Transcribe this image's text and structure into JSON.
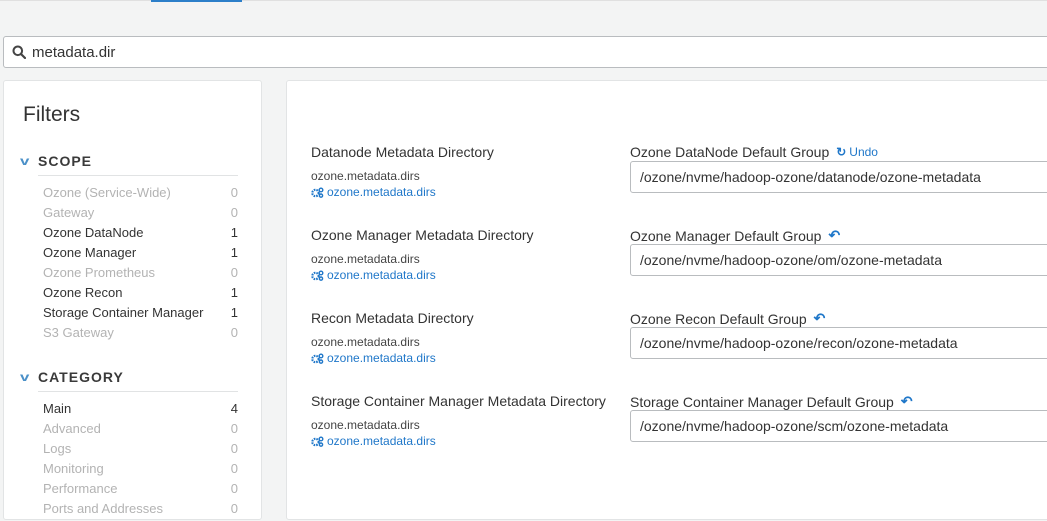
{
  "search": {
    "value": "metadata.dir"
  },
  "filters": {
    "title": "Filters",
    "scope": {
      "label": "SCOPE",
      "items": [
        {
          "label": "Ozone (Service-Wide)",
          "count": "0",
          "active": false
        },
        {
          "label": "Gateway",
          "count": "0",
          "active": false
        },
        {
          "label": "Ozone DataNode",
          "count": "1",
          "active": true
        },
        {
          "label": "Ozone Manager",
          "count": "1",
          "active": true
        },
        {
          "label": "Ozone Prometheus",
          "count": "0",
          "active": false
        },
        {
          "label": "Ozone Recon",
          "count": "1",
          "active": true
        },
        {
          "label": "Storage Container Manager",
          "count": "1",
          "active": true
        },
        {
          "label": "S3 Gateway",
          "count": "0",
          "active": false
        }
      ]
    },
    "category": {
      "label": "CATEGORY",
      "items": [
        {
          "label": "Main",
          "count": "4",
          "active": true
        },
        {
          "label": "Advanced",
          "count": "0",
          "active": false
        },
        {
          "label": "Logs",
          "count": "0",
          "active": false
        },
        {
          "label": "Monitoring",
          "count": "0",
          "active": false
        },
        {
          "label": "Performance",
          "count": "0",
          "active": false
        },
        {
          "label": "Ports and Addresses",
          "count": "0",
          "active": false
        }
      ]
    }
  },
  "configs": [
    {
      "title": "Datanode Metadata Directory",
      "key": "ozone.metadata.dirs",
      "link": "ozone.metadata.dirs",
      "group": "Ozone DataNode Default Group",
      "action": "undo",
      "undo_label": "Undo",
      "value": "/ozone/nvme/hadoop-ozone/datanode/ozone-metadata"
    },
    {
      "title": "Ozone Manager Metadata Directory",
      "key": "ozone.metadata.dirs",
      "link": "ozone.metadata.dirs",
      "group": "Ozone Manager Default Group",
      "action": "revert",
      "value": "/ozone/nvme/hadoop-ozone/om/ozone-metadata"
    },
    {
      "title": "Recon Metadata Directory",
      "key": "ozone.metadata.dirs",
      "link": "ozone.metadata.dirs",
      "group": "Ozone Recon Default Group",
      "action": "revert",
      "value": "/ozone/nvme/hadoop-ozone/recon/ozone-metadata"
    },
    {
      "title": "Storage Container Manager Metadata Directory",
      "key": "ozone.metadata.dirs",
      "link": "ozone.metadata.dirs",
      "group": "Storage Container Manager Default Group",
      "action": "revert",
      "value": "/ozone/nvme/hadoop-ozone/scm/ozone-metadata"
    }
  ],
  "colors": {
    "accent": "#1f77c9",
    "tab_underline": "#2c7fc9"
  }
}
